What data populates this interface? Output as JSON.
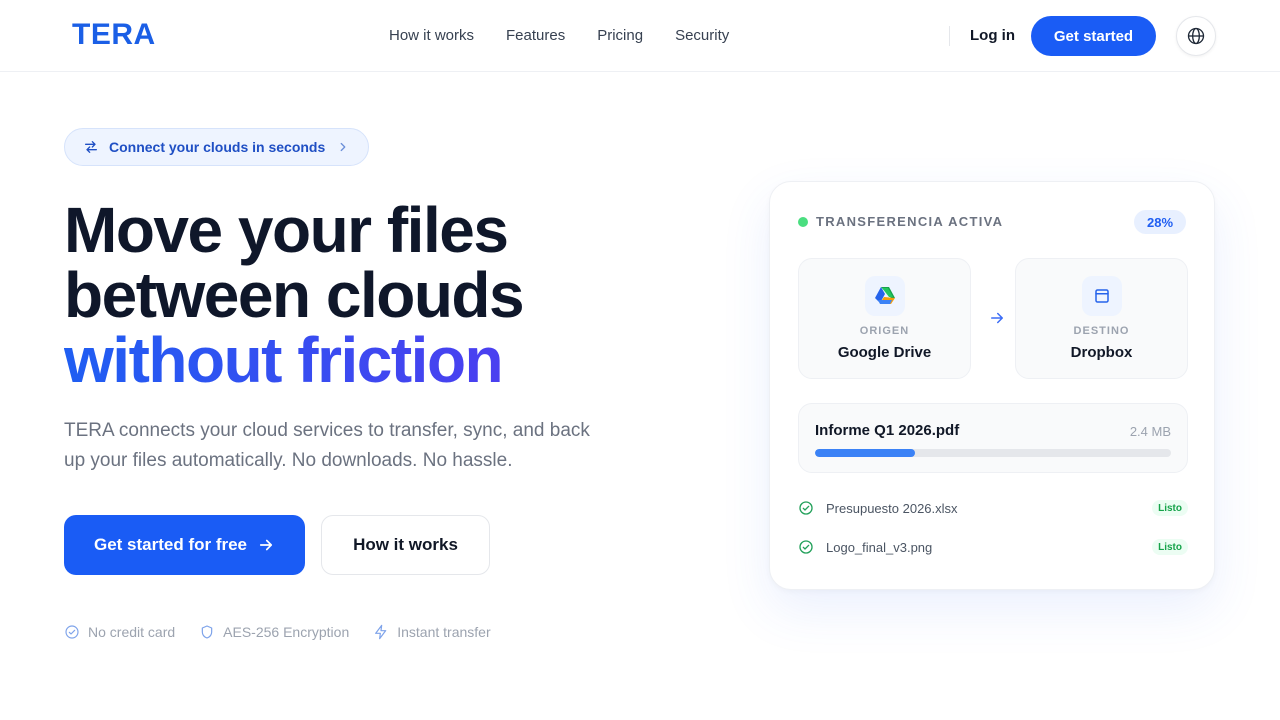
{
  "header": {
    "logo": "TERA",
    "nav": [
      "How it works",
      "Features",
      "Pricing",
      "Security"
    ],
    "login": "Log in",
    "cta": "Get started",
    "icons": {
      "language": "globe-icon"
    }
  },
  "hero": {
    "pill": {
      "label": "Connect your clouds in seconds",
      "icon": "swap-arrows-icon"
    },
    "title_line1": "Move your files",
    "title_line2": "between clouds",
    "title_accent": "without friction",
    "subtitle": "TERA connects your cloud services to transfer, sync, and back up your files automatically. No downloads. No hassle.",
    "cta_primary": "Get started for free",
    "cta_secondary": "How it works",
    "features": [
      {
        "label": "No credit card",
        "icon": "check-circle-icon"
      },
      {
        "label": "AES-256 Encryption",
        "icon": "shield-icon"
      },
      {
        "label": "Instant transfer",
        "icon": "lightning-icon"
      }
    ]
  },
  "card": {
    "status": "TRANSFERENCIA ACTIVA",
    "progress_label": "28%",
    "progress": 0.28,
    "source": {
      "label": "ORIGEN",
      "name": "Google Drive"
    },
    "destination": {
      "label": "DESTINO",
      "name": "Dropbox"
    },
    "current_file": {
      "name": "Informe Q1 2026.pdf",
      "size": "2.4 MB"
    },
    "completed": [
      {
        "name": "Presupuesto 2026.xlsx",
        "status": "Listo"
      },
      {
        "name": "Logo_final_v3.png",
        "status": "Listo"
      }
    ]
  },
  "colors": {
    "brand": "#1a5cf5",
    "accent_gradient_end": "#4b3ff0",
    "success": "#16a34a",
    "active_dot": "#4ade80"
  }
}
